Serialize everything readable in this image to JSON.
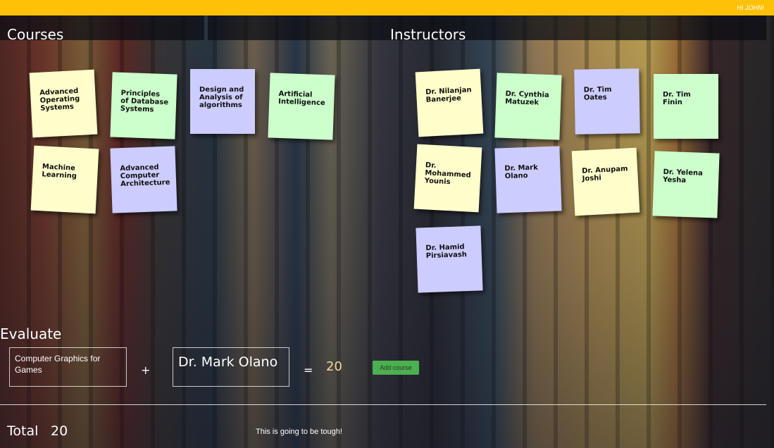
{
  "header": {
    "greeting": "HI JOHN!"
  },
  "courses": {
    "title": "Courses",
    "items": [
      "Advanced Operating Systems",
      "Principles of Database Systems",
      "Design and Analysis of algorithms",
      "Artificial Intelligence",
      "Machine Learning",
      "Advanced Computer Architecture"
    ]
  },
  "instructors": {
    "title": "Instructors",
    "items": [
      "Dr. Nilanjan Banerjee",
      "Dr. Cynthia Matuzek",
      "Dr. Tim Oates",
      "Dr. Tim Finin",
      "Dr. Mohammed Younis",
      "Dr. Mark Olano",
      "Dr. Anupam Joshi",
      "Dr. Yelena Yesha",
      "Dr. Hamid Pirsiavash"
    ]
  },
  "evaluate": {
    "title": "Evaluate",
    "course_value": "Computer Graphics for Games",
    "plus": "+",
    "instructor_value": "Dr. Mark Olano",
    "equals": "=",
    "result": "20",
    "add_button": "Add course"
  },
  "footer": {
    "total_label": "Total",
    "total_value": "20",
    "message": "This is going to be tough!"
  },
  "colors": {
    "topbar": "#ffc107",
    "note_yellow": "#ffffcc",
    "note_green": "#ccffcc",
    "note_purple": "#ccccff",
    "add_button": "#4caf50"
  }
}
